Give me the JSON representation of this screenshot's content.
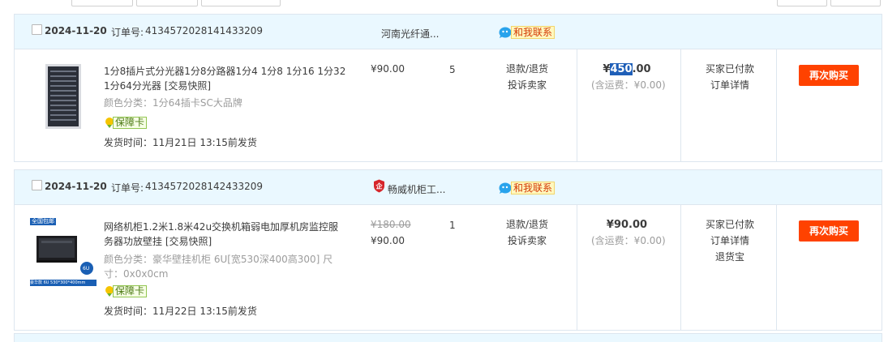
{
  "orders": [
    {
      "date": "2024-11-20",
      "order_label": "订单号:",
      "order_no": "4134572028141433209",
      "shop_name": "河南光纤通...",
      "contact_label": "和我联系",
      "product": {
        "title": "1分8插片式分光器1分8分路器1分4 1分8 1分16 1分32 1分64分光器 [交易快照]",
        "attr": "颜色分类：1分64插卡SC大品牌",
        "guarantee": "保障卡",
        "ship_time": "发货时间：11月21日 13:15前发货",
        "price": "¥90.00",
        "qty": "5"
      },
      "service_links": [
        "退款/退货",
        "投诉卖家"
      ],
      "total": {
        "prefix": "¥",
        "selected": "450",
        "suffix": ".00",
        "ship_fee": "(含运费：¥0.00)"
      },
      "status_links": [
        "买家已付款",
        "订单详情"
      ],
      "rebuy_label": "再次购买"
    },
    {
      "date": "2024-11-20",
      "order_label": "订单号:",
      "order_no": "4134572028142433209",
      "shop_name": "畅威机柜工...",
      "contact_label": "和我联系",
      "product": {
        "title": "网络机柜1.2米1.8米42u交换机箱弱电加厚机房监控服务器功放壁挂 [交易快照]",
        "attr": "颜色分类：豪华壁挂机柜 6U[宽530深400高300]  尺寸：0x0x0cm",
        "guarantee": "保障卡",
        "ship_time": "发货时间：11月22日 13:15前发货",
        "old_price": "¥180.00",
        "price": "¥90.00",
        "qty": "1",
        "thumb_tag": "全国包邮",
        "thumb_caption": "豪华款 6U 530*300*400mm",
        "thumb_badge": "6U"
      },
      "service_links": [
        "退款/退货",
        "投诉卖家"
      ],
      "total": {
        "amount": "¥90.00",
        "ship_fee": "(含运费：¥0.00)"
      },
      "status_links": [
        "买家已付款",
        "订单详情",
        "退货宝"
      ],
      "rebuy_label": "再次购买"
    }
  ],
  "colors": {
    "header_bg": "#eaf8ff",
    "border": "#dde6ef",
    "accent": "#ff4200",
    "muted": "#9c9c9c"
  }
}
